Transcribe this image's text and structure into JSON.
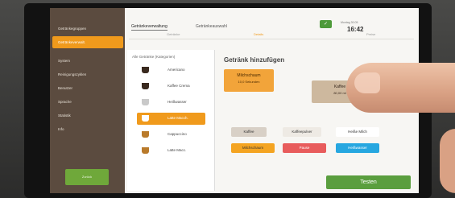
{
  "sidebar": {
    "items": [
      {
        "label": "Getränkegruppen"
      },
      {
        "label": "Getränkeverwalt."
      },
      {
        "label": "System"
      },
      {
        "label": "Reinigungszyklen"
      },
      {
        "label": "Benutzer"
      },
      {
        "label": "Sprache"
      },
      {
        "label": "Statistik"
      },
      {
        "label": "Info"
      }
    ],
    "bottom_label": "Zurück"
  },
  "header": {
    "tabs": [
      "Getränkeverwaltung",
      "Getränkeauswahl"
    ],
    "date": "Montag 30.05",
    "time": "16:42",
    "action_icon": "check-icon"
  },
  "subtabs": [
    "Getränke",
    "Details",
    "Preise"
  ],
  "drink_list": {
    "header": "Alle Getränke (Kategorien)",
    "items": [
      "Americano",
      "Kaffee Crema",
      "Heißwasser",
      "Latte Macch.",
      "Cappuccino",
      "Latte Macc."
    ]
  },
  "panel": {
    "title": "Getränk hinzufügen",
    "slot1_line1": "Milchschaum",
    "slot1_line2": "10,0 Sekunden",
    "slot2_line1": "Kaffee",
    "slot2_line2": "80,00 ml",
    "ingredients": [
      "Kaffee",
      "Kaffeepulver",
      "Heiße Milch",
      "Milchschaum",
      "Pause",
      "Heißwasser"
    ],
    "test_button": "Testen"
  },
  "colors": {
    "accent": "#f09a1c",
    "sidebar_bg": "#5b4b3f",
    "success": "#5a9e3e"
  }
}
